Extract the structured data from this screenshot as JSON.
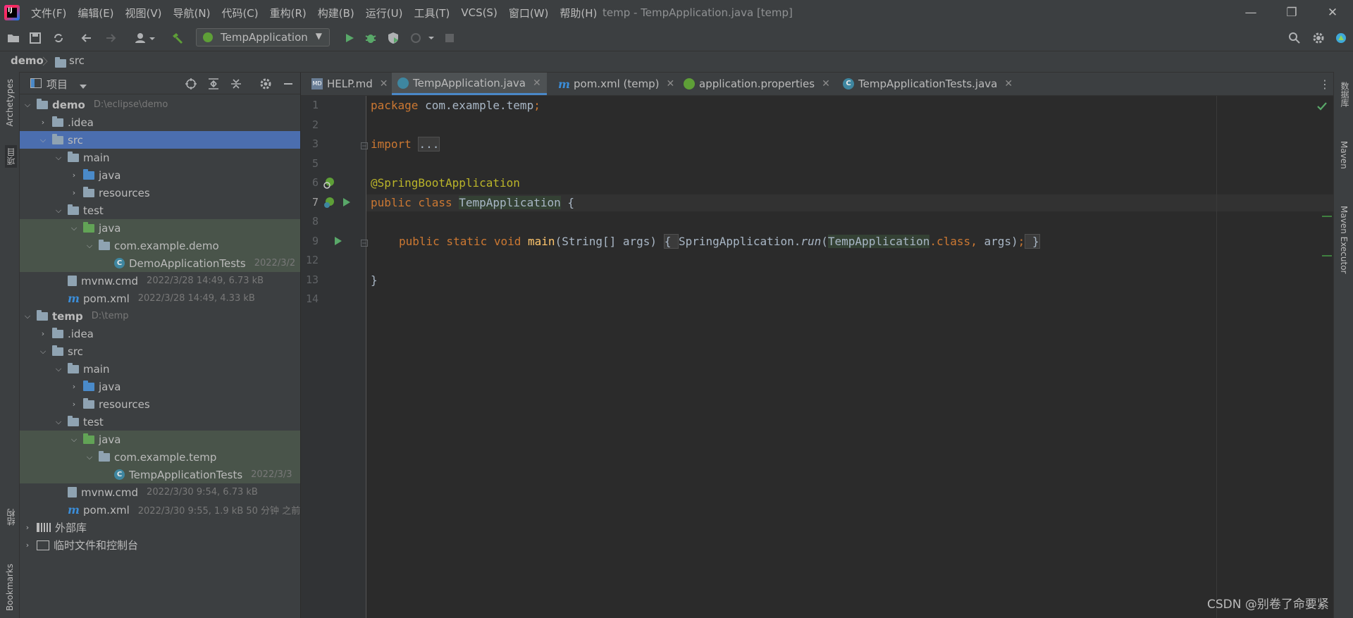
{
  "menu": [
    "文件(F)",
    "编辑(E)",
    "视图(V)",
    "导航(N)",
    "代码(C)",
    "重构(R)",
    "构建(B)",
    "运行(U)",
    "工具(T)",
    "VCS(S)",
    "窗口(W)",
    "帮助(H)"
  ],
  "window_title": "temp - TempApplication.java [temp]",
  "window_controls": {
    "minimize": "—",
    "restore": "❐",
    "close": "✕"
  },
  "run_config": "TempApplication",
  "breadcrumb": {
    "project": "demo",
    "folder": "src"
  },
  "left_strip": {
    "archetypes": "Archetypes",
    "project": "项目",
    "structure": "结构",
    "bookmarks": "Bookmarks"
  },
  "right_strip": {
    "database": "数据库",
    "maven": "Maven",
    "maven_executor": "Maven Executor"
  },
  "project_panel": {
    "title": "项目"
  },
  "tree": [
    {
      "label": "demo",
      "meta": "D:\\eclipse\\demo"
    },
    {
      "label": ".idea",
      "meta": ""
    },
    {
      "label": "src",
      "meta": ""
    },
    {
      "label": "main",
      "meta": ""
    },
    {
      "label": "java",
      "meta": ""
    },
    {
      "label": "resources",
      "meta": ""
    },
    {
      "label": "test",
      "meta": ""
    },
    {
      "label": "java",
      "meta": ""
    },
    {
      "label": "com.example.demo",
      "meta": ""
    },
    {
      "label": "DemoApplicationTests",
      "meta": "2022/3/2"
    },
    {
      "label": "mvnw.cmd",
      "meta": "2022/3/28 14:49, 6.73 kB"
    },
    {
      "label": "pom.xml",
      "meta": "2022/3/28 14:49, 4.33 kB"
    },
    {
      "label": "temp",
      "meta": "D:\\temp"
    },
    {
      "label": ".idea",
      "meta": ""
    },
    {
      "label": "src",
      "meta": ""
    },
    {
      "label": "main",
      "meta": ""
    },
    {
      "label": "java",
      "meta": ""
    },
    {
      "label": "resources",
      "meta": ""
    },
    {
      "label": "test",
      "meta": ""
    },
    {
      "label": "java",
      "meta": ""
    },
    {
      "label": "com.example.temp",
      "meta": ""
    },
    {
      "label": "TempApplicationTests",
      "meta": "2022/3/3"
    },
    {
      "label": "mvnw.cmd",
      "meta": "2022/3/30 9:54, 6.73 kB"
    },
    {
      "label": "pom.xml",
      "meta": "2022/3/30 9:55, 1.9 kB 50 分钟 之前"
    },
    {
      "label": "外部库",
      "meta": ""
    },
    {
      "label": "临时文件和控制台",
      "meta": ""
    }
  ],
  "tabs": [
    {
      "label": "HELP.md",
      "icon": "md-icon"
    },
    {
      "label": "TempApplication.java",
      "icon": "spring-class-icon"
    },
    {
      "label": "pom.xml (temp)",
      "icon": "maven-icon"
    },
    {
      "label": "application.properties",
      "icon": "spring-properties-icon"
    },
    {
      "label": "TempApplicationTests.java",
      "icon": "class-icon"
    }
  ],
  "line_numbers": [
    "1",
    "2",
    "3",
    "5",
    "6",
    "7",
    "8",
    "9",
    "12",
    "13",
    "14"
  ],
  "code": {
    "l1_kw": "package",
    "l1_rest": " com.example.temp",
    "l1_semi": ";",
    "l3_kw": "import",
    "l3_fold": "...",
    "l6_ann": "@SpringBootApplication",
    "l7_kw": "public class ",
    "l7_cls": "TempApplication",
    "l7_rest": " {",
    "l9_kw": "public static void ",
    "l9_fn": "main",
    "l9_args": "(String[] args) ",
    "l9_brace1": "{ ",
    "l9_call": "SpringApplication.",
    "l9_run": "run",
    "l9_paren": "(",
    "l9_cls": "TempApplication",
    "l9_dotclass": ".class, ",
    "l9_args2": "args)",
    "l9_semi": ";",
    "l9_brace2": " }",
    "l13": "}"
  },
  "watermark": "CSDN @别卷了命要紧"
}
